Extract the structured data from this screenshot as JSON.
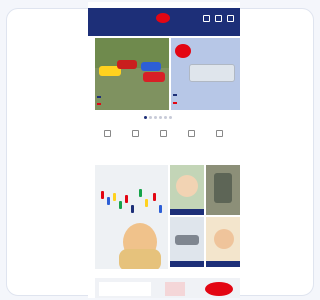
{
  "header": {
    "left_text": "",
    "nav": [
      "",
      "",
      "",
      "",
      "",
      ""
    ]
  },
  "hero": {
    "burst_text": "",
    "left_tag": "",
    "left_sub": "",
    "right_tag": "",
    "right_sub": ""
  },
  "section": {
    "title": ""
  },
  "colors": {
    "brand_blue": "#1d2f78",
    "brand_red": "#e30613"
  }
}
